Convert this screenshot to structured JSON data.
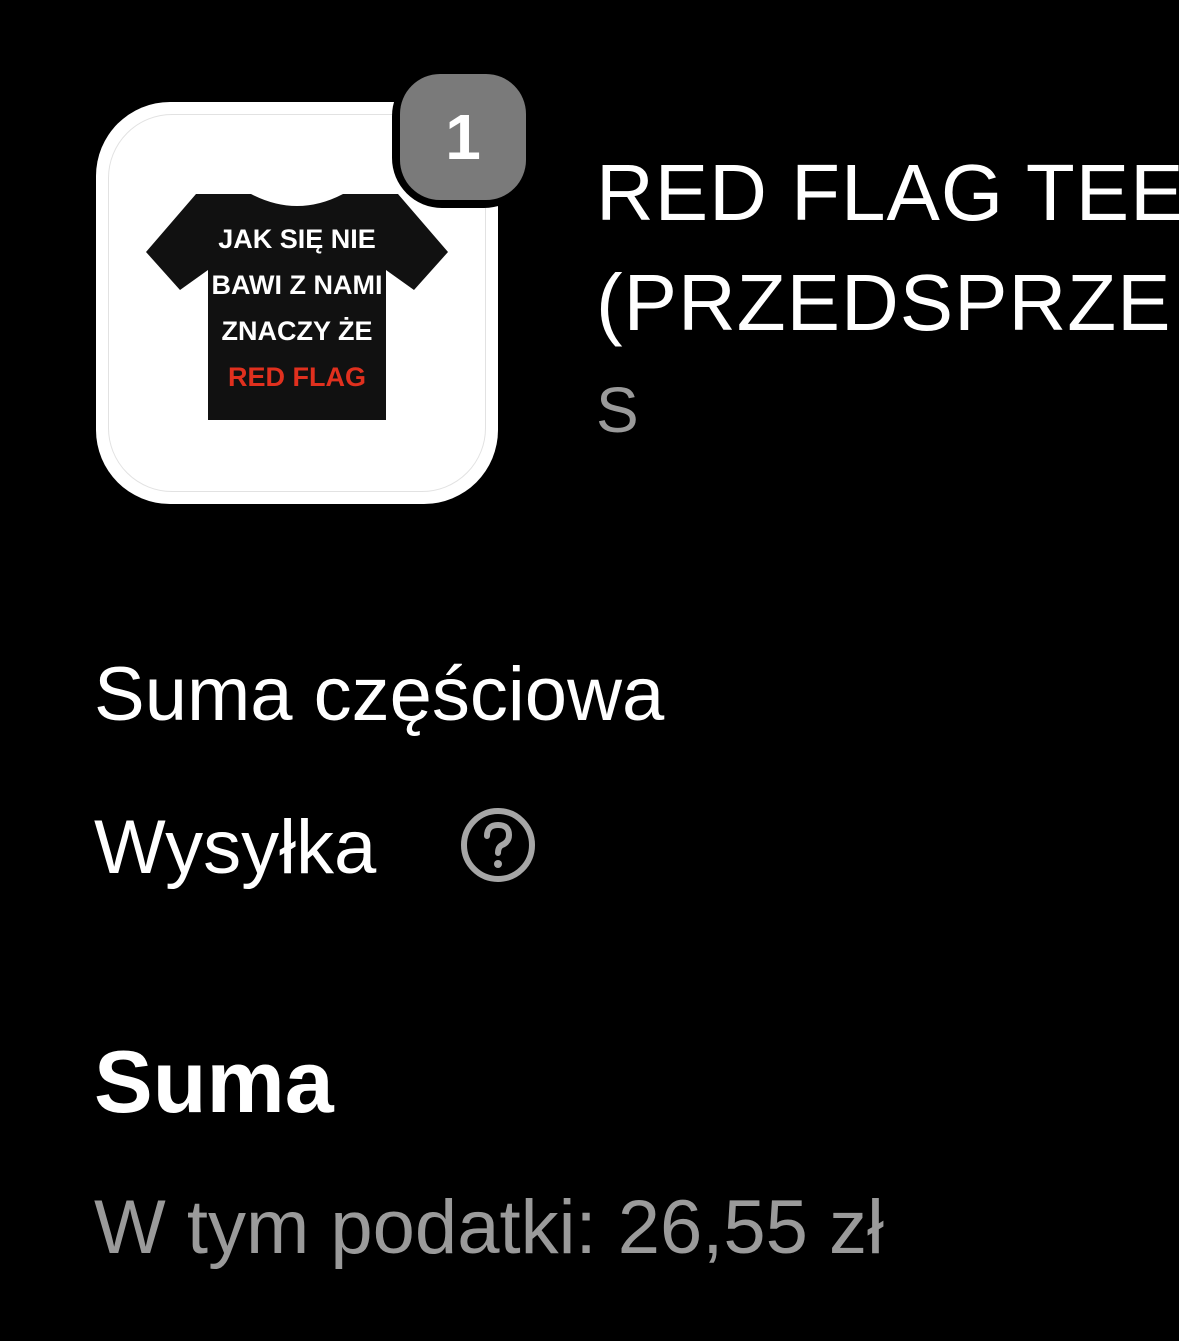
{
  "line_item": {
    "quantity": "1",
    "title_line1": "RED FLAG TEE",
    "title_line2": "(PRZEDSPRZE",
    "variant": "S",
    "image": {
      "shirt_text": [
        "JAK SIĘ NIE",
        "BAWI Z NAMI",
        "ZNACZY ŻE",
        "RED FLAG"
      ],
      "shirt_color": "#111111",
      "accent_color": "#e0301e"
    }
  },
  "summary": {
    "subtotal_label": "Suma częściowa",
    "shipping_label": "Wysyłka",
    "shipping_help_icon": "question-circle-icon",
    "total_label": "Suma",
    "taxes_note": "W tym podatki: 26,55 zł"
  }
}
